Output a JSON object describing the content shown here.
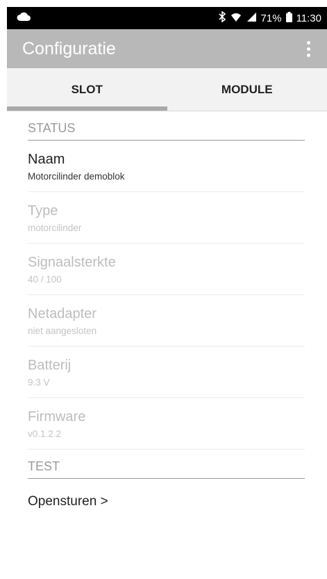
{
  "status_bar": {
    "left_icon": "cloud-icon",
    "icons": [
      "bluetooth-icon",
      "wifi-icon",
      "signal-icon"
    ],
    "battery": "71%",
    "time": "11:30"
  },
  "app_bar": {
    "title": "Configuratie",
    "menu_icon": "more-vert-icon"
  },
  "tabs": [
    {
      "label": "SLOT",
      "active": true
    },
    {
      "label": "MODULE",
      "active": false
    }
  ],
  "sections": {
    "status": {
      "header": "STATUS",
      "items": [
        {
          "title": "Naam",
          "subtitle": "Motorcilinder demoblok",
          "enabled": true
        },
        {
          "title": "Type",
          "subtitle": "motorcilinder",
          "enabled": false
        },
        {
          "title": "Signaalsterkte",
          "subtitle": "40 / 100",
          "enabled": false
        },
        {
          "title": "Netadapter",
          "subtitle": "niet aangesloten",
          "enabled": false
        },
        {
          "title": "Batterij",
          "subtitle": "9.3 V",
          "enabled": false
        },
        {
          "title": "Firmware",
          "subtitle": "v0.1.2.2",
          "enabled": false
        }
      ]
    },
    "test": {
      "header": "TEST",
      "action_label": "Opensturen >"
    }
  }
}
